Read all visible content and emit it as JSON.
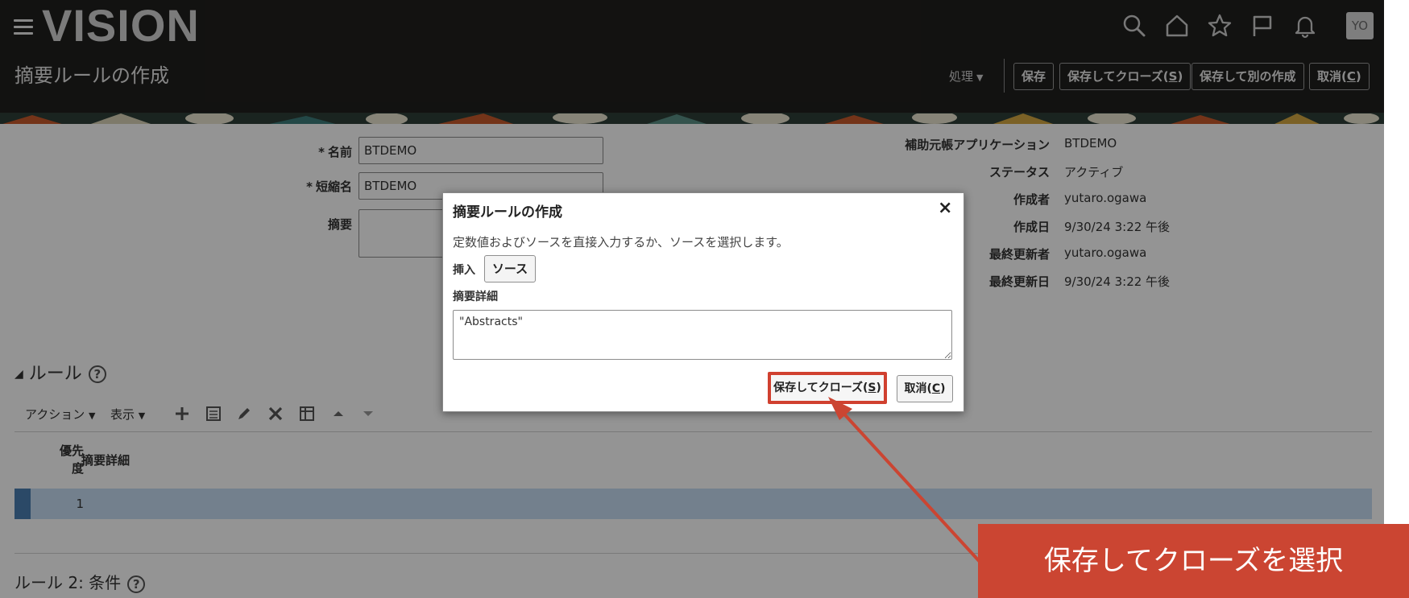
{
  "header": {
    "logo": "VISION",
    "page_title": "摘要ルールの作成",
    "avatar_initials": "YO",
    "actions_menu": "処理",
    "buttons": {
      "save": "保存",
      "save_close_prefix": "保存してクローズ(",
      "save_close_key": "S",
      "save_create_another": "保存して別の作成",
      "cancel_prefix": "取消(",
      "cancel_key": "C",
      "paren_close": ")"
    },
    "icons": [
      "search-icon",
      "home-icon",
      "star-icon",
      "flag-icon",
      "bell-icon"
    ]
  },
  "form": {
    "name_label": "名前",
    "name_value": "BTDEMO",
    "short_name_label": "短縮名",
    "short_name_value": "BTDEMO",
    "description_label": "摘要",
    "required_mark": "*"
  },
  "info": {
    "subledger_app_label": "補助元帳アプリケーション",
    "subledger_app_value": "BTDEMO",
    "status_label": "ステータス",
    "status_value": "アクティブ",
    "created_by_label": "作成者",
    "created_by_value": "yutaro.ogawa",
    "created_date_label": "作成日",
    "created_date_value": "9/30/24 3:22 午後",
    "updated_by_label": "最終更新者",
    "updated_by_value": "yutaro.ogawa",
    "updated_date_label": "最終更新日",
    "updated_date_value": "9/30/24 3:22 午後"
  },
  "rules": {
    "section_title": "ルール",
    "toolbar": {
      "actions": "アクション",
      "view": "表示"
    },
    "columns": {
      "priority_line1": "優先",
      "priority_line2": "度",
      "detail": "摘要詳細"
    },
    "rows": [
      {
        "priority": "1",
        "detail": ""
      }
    ],
    "rule2_title": "ルール 2: 条件"
  },
  "dialog": {
    "title": "摘要ルールの作成",
    "instruction": "定数値およびソースを直接入力するか、ソースを選択します。",
    "insert_label": "挿入",
    "source_button": "ソース",
    "detail_label": "摘要詳細",
    "detail_value": "\"Abstracts\"",
    "save_close_prefix": "保存してクローズ(",
    "save_close_key": "S",
    "cancel_prefix": "取消(",
    "cancel_key": "C",
    "paren_close": ")"
  },
  "callout": {
    "text": "保存してクローズを選択",
    "color": "#cb4532"
  },
  "colors": {
    "header_bg": "#201f1e",
    "highlight_row": "#c6ddf3",
    "accent_border": "#d0402f"
  }
}
